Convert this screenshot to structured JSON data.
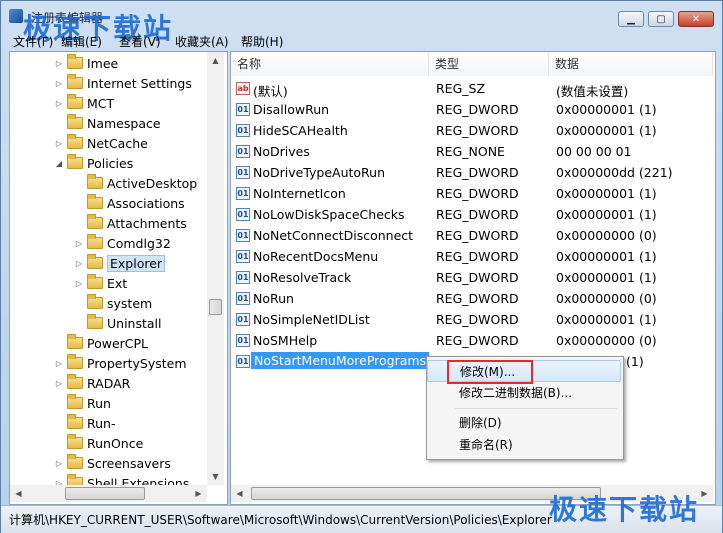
{
  "window": {
    "title": "注册表编辑器"
  },
  "watermark": {
    "top": "极速下载站",
    "bottom": "极速下载站"
  },
  "menu": [
    "文件(F)",
    "编辑(E)",
    "查看(V)",
    "收藏夹(A)",
    "帮助(H)"
  ],
  "tree": [
    {
      "label": "Imee",
      "expander": "▷"
    },
    {
      "label": "Internet Settings",
      "expander": "▷"
    },
    {
      "label": "MCT",
      "expander": "▷"
    },
    {
      "label": "Namespace",
      "expander": ""
    },
    {
      "label": "NetCache",
      "expander": "▷"
    },
    {
      "label": "Policies",
      "expander": "◢"
    },
    {
      "label": "ActiveDesktop",
      "expander": ""
    },
    {
      "label": "Associations",
      "expander": ""
    },
    {
      "label": "Attachments",
      "expander": ""
    },
    {
      "label": "Comdlg32",
      "expander": "▷"
    },
    {
      "label": "Explorer",
      "expander": "▷"
    },
    {
      "label": "Ext",
      "expander": "▷"
    },
    {
      "label": "system",
      "expander": ""
    },
    {
      "label": "Uninstall",
      "expander": ""
    },
    {
      "label": "PowerCPL",
      "expander": ""
    },
    {
      "label": "PropertySystem",
      "expander": "▷"
    },
    {
      "label": "RADAR",
      "expander": "▷"
    },
    {
      "label": "Run",
      "expander": ""
    },
    {
      "label": "Run-",
      "expander": ""
    },
    {
      "label": "RunOnce",
      "expander": ""
    },
    {
      "label": "Screensavers",
      "expander": "▷"
    },
    {
      "label": "Shell Extensions",
      "expander": "▷"
    }
  ],
  "columns": {
    "name": "名称",
    "type": "类型",
    "data": "数据"
  },
  "values": [
    {
      "name": "(默认)",
      "type": "REG_SZ",
      "data": "(数值未设置)",
      "icon": "string-value-icon"
    },
    {
      "name": "DisallowRun",
      "type": "REG_DWORD",
      "data": "0x00000001 (1)",
      "icon": "binary-value-icon"
    },
    {
      "name": "HideSCAHealth",
      "type": "REG_DWORD",
      "data": "0x00000001 (1)",
      "icon": "binary-value-icon"
    },
    {
      "name": "NoDrives",
      "type": "REG_NONE",
      "data": "00 00 00 01",
      "icon": "binary-value-icon"
    },
    {
      "name": "NoDriveTypeAutoRun",
      "type": "REG_DWORD",
      "data": "0x000000dd (221)",
      "icon": "binary-value-icon"
    },
    {
      "name": "NoInternetIcon",
      "type": "REG_DWORD",
      "data": "0x00000001 (1)",
      "icon": "binary-value-icon"
    },
    {
      "name": "NoLowDiskSpaceChecks",
      "type": "REG_DWORD",
      "data": "0x00000001 (1)",
      "icon": "binary-value-icon"
    },
    {
      "name": "NoNetConnectDisconnect",
      "type": "REG_DWORD",
      "data": "0x00000000 (0)",
      "icon": "binary-value-icon"
    },
    {
      "name": "NoRecentDocsMenu",
      "type": "REG_DWORD",
      "data": "0x00000001 (1)",
      "icon": "binary-value-icon"
    },
    {
      "name": "NoResolveTrack",
      "type": "REG_DWORD",
      "data": "0x00000001 (1)",
      "icon": "binary-value-icon"
    },
    {
      "name": "NoRun",
      "type": "REG_DWORD",
      "data": "0x00000000 (0)",
      "icon": "binary-value-icon"
    },
    {
      "name": "NoSimpleNetIDList",
      "type": "REG_DWORD",
      "data": "0x00000001 (1)",
      "icon": "binary-value-icon"
    },
    {
      "name": "NoSMHelp",
      "type": "REG_DWORD",
      "data": "0x00000000 (0)",
      "icon": "binary-value-icon"
    },
    {
      "name": "NoStartMenuMorePrograms",
      "type": "",
      "data": "(1)",
      "icon": "binary-value-icon"
    }
  ],
  "context_menu": [
    "修改(M)...",
    "修改二进制数据(B)...",
    "删除(D)",
    "重命名(R)"
  ],
  "status": "计算机\\HKEY_CURRENT_USER\\Software\\Microsoft\\Windows\\CurrentVersion\\Policies\\Explorer",
  "colors": {
    "selection": "#3399ff",
    "highlight_box": "#e02b2b",
    "watermark": "#1b6bd6"
  }
}
